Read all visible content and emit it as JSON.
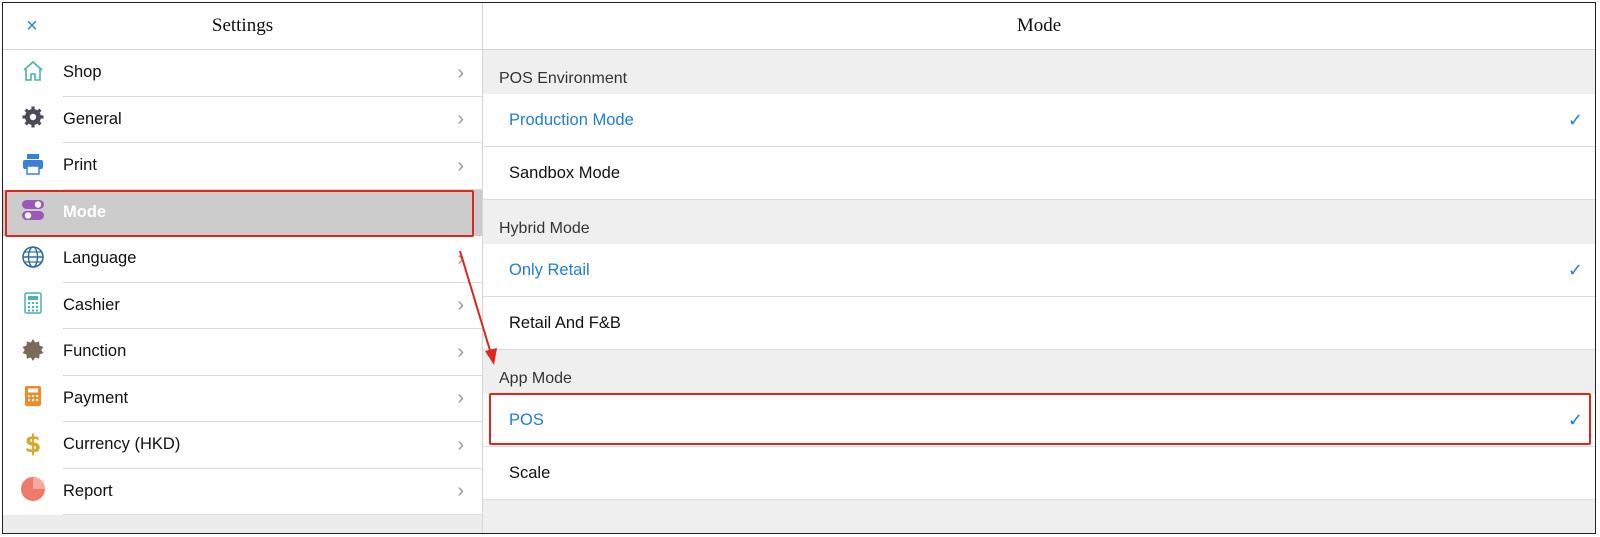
{
  "left_panel": {
    "title": "Settings",
    "close_glyph": "×",
    "items": [
      {
        "label": "Shop",
        "icon": "home-icon",
        "color": "#4ab4a8"
      },
      {
        "label": "General",
        "icon": "gear-icon",
        "color": "#4a4a5a"
      },
      {
        "label": "Print",
        "icon": "printer-icon",
        "color": "#3a7fd8"
      },
      {
        "label": "Mode",
        "icon": "toggle-icon",
        "color": "#9b59b6",
        "selected": true
      },
      {
        "label": "Language",
        "icon": "globe-icon",
        "color": "#2b6ca3"
      },
      {
        "label": "Cashier",
        "icon": "calculator-icon",
        "color": "#4ab4a8"
      },
      {
        "label": "Function",
        "icon": "badge-icon",
        "color": "#7a6a5a"
      },
      {
        "label": "Payment",
        "icon": "calculator-icon",
        "color": "#f08a24"
      },
      {
        "label": "Currency (HKD)",
        "icon": "dollar-icon",
        "color": "#d8a828"
      },
      {
        "label": "Report",
        "icon": "pie-chart-icon",
        "color": "#f07a6a"
      }
    ]
  },
  "right_panel": {
    "title": "Mode",
    "sections": [
      {
        "heading": "POS Environment",
        "options": [
          {
            "label": "Production Mode",
            "active": true
          },
          {
            "label": "Sandbox Mode",
            "active": false
          }
        ]
      },
      {
        "heading": "Hybrid Mode",
        "options": [
          {
            "label": "Only Retail",
            "active": true
          },
          {
            "label": "Retail And F&B",
            "active": false
          }
        ]
      },
      {
        "heading": "App Mode",
        "options": [
          {
            "label": "POS",
            "active": true,
            "highlighted": true
          },
          {
            "label": "Scale",
            "active": false
          }
        ]
      }
    ],
    "check_glyph": "✓"
  },
  "colors": {
    "accent": "#1f7fd6",
    "highlight": "#e0261c",
    "selected_bg": "#cccccc"
  }
}
